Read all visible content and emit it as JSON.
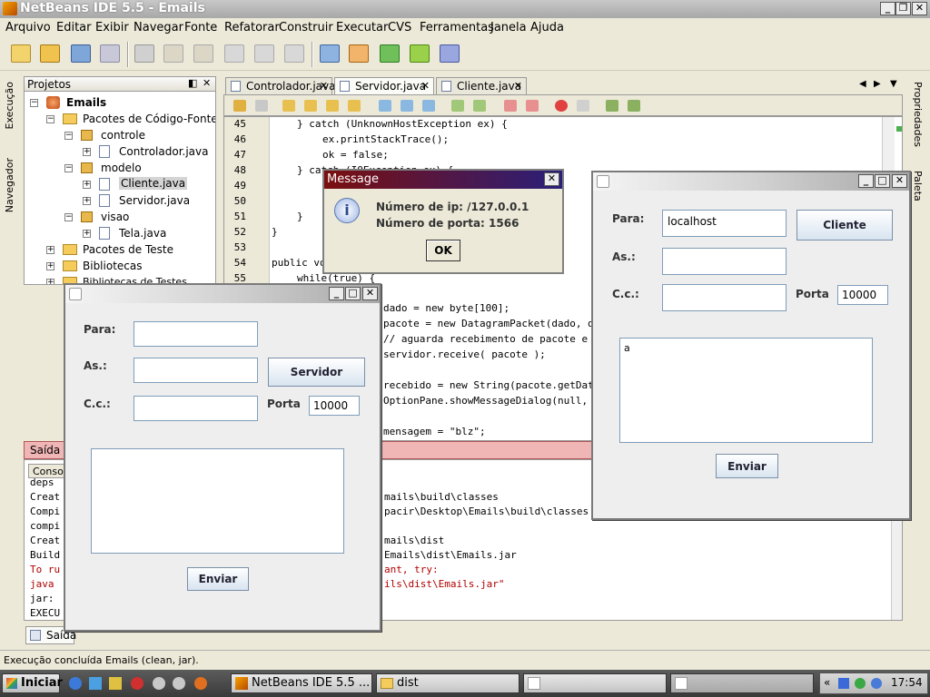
{
  "window": {
    "title": "NetBeans IDE 5.5 - Emails"
  },
  "menu": [
    "Arquivo",
    "Editar",
    "Exibir",
    "Navegar",
    "Fonte",
    "Refatorar",
    "Construir",
    "Executar",
    "CVS",
    "Ferramentas",
    "Janela",
    "Ajuda"
  ],
  "left_strip": {
    "execucao": "Execução",
    "navegador": "Navegador"
  },
  "right_strip": {
    "propriedades": "Propriedades",
    "paleta": "Paleta"
  },
  "projects": {
    "title": "Projetos",
    "tree": [
      {
        "label": "Emails",
        "level": 0,
        "type": "project",
        "bold": true
      },
      {
        "label": "Pacotes de Código-Fonte",
        "level": 1,
        "type": "folder"
      },
      {
        "label": "controle",
        "level": 2,
        "type": "package"
      },
      {
        "label": "Controlador.java",
        "level": 3,
        "type": "file"
      },
      {
        "label": "modelo",
        "level": 2,
        "type": "package"
      },
      {
        "label": "Cliente.java",
        "level": 3,
        "type": "file",
        "selected": true
      },
      {
        "label": "Servidor.java",
        "level": 3,
        "type": "file"
      },
      {
        "label": "visao",
        "level": 2,
        "type": "package"
      },
      {
        "label": "Tela.java",
        "level": 3,
        "type": "file"
      },
      {
        "label": "Pacotes de Teste",
        "level": 1,
        "type": "folder"
      },
      {
        "label": "Bibliotecas",
        "level": 1,
        "type": "folder"
      },
      {
        "label": "Bibliotecas de Testes",
        "level": 1,
        "type": "folder"
      }
    ]
  },
  "editor": {
    "tabs": [
      {
        "label": "Controlador.java",
        "active": false
      },
      {
        "label": "Servidor.java",
        "active": true
      },
      {
        "label": "Cliente.java",
        "active": false
      }
    ],
    "lines": [
      {
        "n": "45",
        "code": "} catch (UnknownHostException ex) {",
        "indent": 4
      },
      {
        "n": "46",
        "code": "ex.printStackTrace();",
        "indent": 8
      },
      {
        "n": "47",
        "code": "ok = false;",
        "indent": 8
      },
      {
        "n": "48",
        "code": "} catch (IOException ex) {",
        "indent": 4
      },
      {
        "n": "49",
        "code": "",
        "indent": 8
      },
      {
        "n": "50",
        "code": "",
        "indent": 8
      },
      {
        "n": "51",
        "code": "}",
        "indent": 4
      },
      {
        "n": "52",
        "code": "}",
        "indent": 0
      },
      {
        "n": "53",
        "code": "",
        "indent": 0
      },
      {
        "n": "54",
        "code": "public void",
        "indent": 0
      },
      {
        "n": "55",
        "code": "while(true) {",
        "indent": 4
      }
    ],
    "hidden_fragments": [
      "dado = new byte[100];",
      "pacote = new DatagramPacket(dado, d",
      "// aguarda recebimento de pacote e",
      "servidor.receive( pacote );",
      "",
      "recebido = new String(pacote.getDat",
      "OptionPane.showMessageDialog(null,",
      "",
      "mensagem = \"blz\";"
    ]
  },
  "output": {
    "title": "Saída",
    "console_tab": "Console",
    "bottom_tab": "Saída",
    "left_lines": [
      "deps",
      "Creat",
      "Compi",
      "compi",
      "Creat",
      "Build",
      "To ru",
      "java",
      "jar:",
      "EXECU"
    ],
    "right_lines": [
      "mails\\build\\classes",
      "pacir\\Desktop\\Emails\\build\\classes",
      "",
      "mails\\dist",
      "Emails\\dist\\Emails.jar",
      "ant, try:",
      "ils\\dist\\Emails.jar\"",
      ""
    ]
  },
  "message_dialog": {
    "title": "Message",
    "line1": "Número de ip: /127.0.0.1",
    "line2": "Número de porta: 1566",
    "ok": "OK"
  },
  "servidor_window": {
    "para_label": "Para:",
    "as_label": "As.:",
    "cc_label": "C.c.:",
    "porta_label": "Porta",
    "porta_value": "10000",
    "action_button": "Servidor",
    "send_button": "Enviar",
    "para_value": "",
    "as_value": "",
    "cc_value": "",
    "body_value": ""
  },
  "cliente_window": {
    "para_label": "Para:",
    "as_label": "As.:",
    "cc_label": "C.c.:",
    "porta_label": "Porta",
    "porta_value": "10000",
    "para_value": "localhost",
    "action_button": "Cliente",
    "send_button": "Enviar",
    "body_value": "a",
    "as_value": "",
    "cc_value": ""
  },
  "status": {
    "text": "Execução concluída Emails (clean, jar)."
  },
  "taskbar": {
    "start": "Iniciar",
    "items": [
      {
        "label": "NetBeans IDE 5.5 ..."
      },
      {
        "label": "dist"
      },
      {
        "label": ""
      },
      {
        "label": ""
      }
    ],
    "clock": "17:54"
  }
}
